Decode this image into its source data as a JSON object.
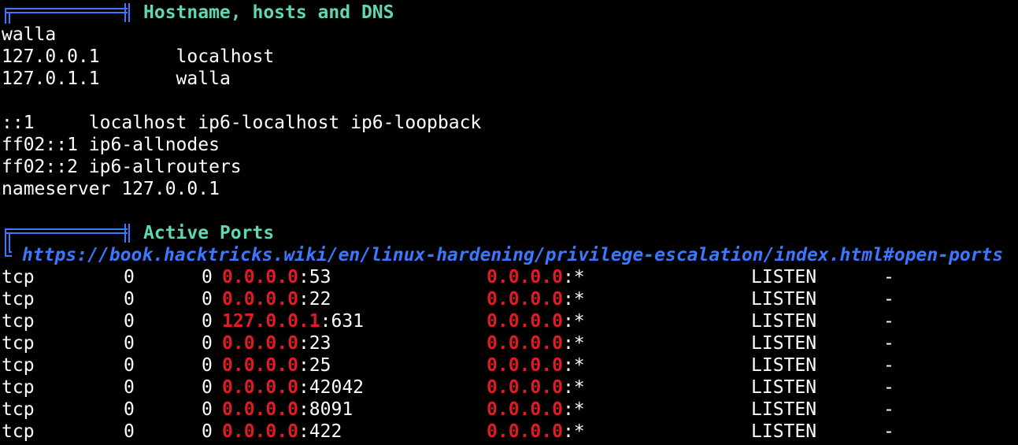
{
  "colors": {
    "background": "#000000",
    "text": "#ffffff",
    "section_title": "#5fd7af",
    "link": "#3b78ff",
    "address": "#e01b24"
  },
  "sections": {
    "hosts": {
      "title": "Hostname, hosts and DNS",
      "lines": [
        "walla",
        "127.0.0.1       localhost",
        "127.0.1.1       walla",
        "",
        "::1     localhost ip6-localhost ip6-loopback",
        "ff02::1 ip6-allnodes",
        "ff02::2 ip6-allrouters",
        "nameserver 127.0.0.1",
        ""
      ]
    },
    "ports": {
      "title": "Active Ports",
      "link": "https://book.hacktricks.wiki/en/linux-hardening/privilege-escalation/index.html#open-ports",
      "rows": [
        {
          "proto": "tcp",
          "recv": "0",
          "send": "0",
          "local_addr": "0.0.0.0",
          "local_port": ":53",
          "foreign_addr": "0.0.0.0",
          "foreign_port": ":*",
          "state": "LISTEN",
          "program": "-"
        },
        {
          "proto": "tcp",
          "recv": "0",
          "send": "0",
          "local_addr": "0.0.0.0",
          "local_port": ":22",
          "foreign_addr": "0.0.0.0",
          "foreign_port": ":*",
          "state": "LISTEN",
          "program": "-"
        },
        {
          "proto": "tcp",
          "recv": "0",
          "send": "0",
          "local_addr": "127.0.0.1",
          "local_port": ":631",
          "foreign_addr": "0.0.0.0",
          "foreign_port": ":*",
          "state": "LISTEN",
          "program": "-"
        },
        {
          "proto": "tcp",
          "recv": "0",
          "send": "0",
          "local_addr": "0.0.0.0",
          "local_port": ":23",
          "foreign_addr": "0.0.0.0",
          "foreign_port": ":*",
          "state": "LISTEN",
          "program": "-"
        },
        {
          "proto": "tcp",
          "recv": "0",
          "send": "0",
          "local_addr": "0.0.0.0",
          "local_port": ":25",
          "foreign_addr": "0.0.0.0",
          "foreign_port": ":*",
          "state": "LISTEN",
          "program": "-"
        },
        {
          "proto": "tcp",
          "recv": "0",
          "send": "0",
          "local_addr": "0.0.0.0",
          "local_port": ":42042",
          "foreign_addr": "0.0.0.0",
          "foreign_port": ":*",
          "state": "LISTEN",
          "program": "-"
        },
        {
          "proto": "tcp",
          "recv": "0",
          "send": "0",
          "local_addr": "0.0.0.0",
          "local_port": ":8091",
          "foreign_addr": "0.0.0.0",
          "foreign_port": ":*",
          "state": "LISTEN",
          "program": "-"
        },
        {
          "proto": "tcp",
          "recv": "0",
          "send": "0",
          "local_addr": "0.0.0.0",
          "local_port": ":422",
          "foreign_addr": "0.0.0.0",
          "foreign_port": ":*",
          "state": "LISTEN",
          "program": "-"
        }
      ]
    }
  }
}
